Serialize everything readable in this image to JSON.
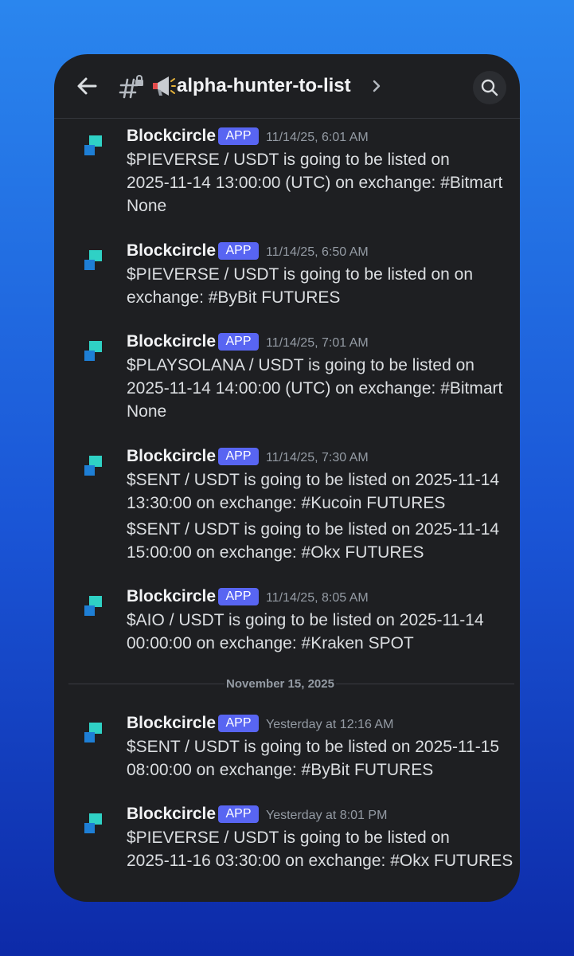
{
  "header": {
    "channel_name": "alpha-hunter-to-list",
    "icons": [
      "back-arrow-icon",
      "locked-hash-icon",
      "megaphone-icon",
      "chevron-right-icon",
      "search-icon"
    ]
  },
  "date_divider": "November 15, 2025",
  "colors": {
    "badge": "#5865f2",
    "background": "#1e1f22",
    "accent_teal": "#2fd1c5",
    "accent_blue": "#1e7fd6"
  },
  "messages": [
    {
      "author": "Blockcircle",
      "badge": "APP",
      "time": "11/14/25, 6:01 AM",
      "lines": [
        "$PIEVERSE / USDT is going to be listed on",
        "2025-11-14 13:00:00 (UTC) on exchange: #Bitmart",
        "None"
      ]
    },
    {
      "author": "Blockcircle",
      "badge": "APP",
      "time": "11/14/25, 6:50 AM",
      "lines": [
        "$PIEVERSE / USDT is going to be listed on  on",
        "exchange: #ByBit FUTURES"
      ]
    },
    {
      "author": "Blockcircle",
      "badge": "APP",
      "time": "11/14/25, 7:01 AM",
      "lines": [
        "$PLAYSOLANA / USDT is going to be listed on",
        "2025-11-14 14:00:00 (UTC) on exchange: #Bitmart",
        "None"
      ]
    },
    {
      "author": "Blockcircle",
      "badge": "APP",
      "time": "11/14/25, 7:30 AM",
      "lines": [
        "$SENT / USDT is going to be listed on 2025-11-14",
        "13:30:00 on exchange: #Kucoin FUTURES"
      ],
      "lines2": [
        "$SENT / USDT is going to be listed on 2025-11-14",
        "15:00:00 on exchange: #Okx FUTURES"
      ]
    },
    {
      "author": "Blockcircle",
      "badge": "APP",
      "time": "11/14/25, 8:05 AM",
      "lines": [
        "$AIO / USDT is going to be listed on 2025-11-14",
        "00:00:00 on exchange: #Kraken SPOT"
      ]
    },
    {
      "author": "Blockcircle",
      "badge": "APP",
      "time": "Yesterday at 12:16 AM",
      "lines": [
        "$SENT / USDT is going to be listed on 2025-11-15",
        "08:00:00 on exchange: #ByBit FUTURES"
      ]
    },
    {
      "author": "Blockcircle",
      "badge": "APP",
      "time": "Yesterday at 8:01 PM",
      "lines": [
        "$PIEVERSE / USDT is going to be listed on",
        "2025-11-16 03:30:00 on exchange: #Okx FUTURES"
      ]
    }
  ]
}
